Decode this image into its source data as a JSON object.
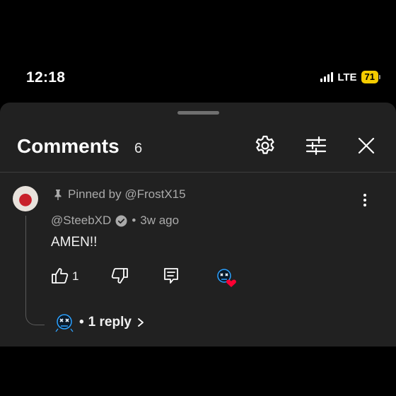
{
  "status_bar": {
    "time": "12:18",
    "network": "LTE",
    "battery": "71"
  },
  "header": {
    "title": "Comments",
    "count": "6"
  },
  "comment": {
    "pinned_label": "Pinned by @FrostX15",
    "author": "@SteebXD",
    "separator": "•",
    "age": "3w ago",
    "text": "AMEN!!",
    "like_count": "1",
    "reply_bullet": "•",
    "reply_label": "1 reply"
  },
  "colors": {
    "sheet_bg": "#212121",
    "battery": "#f5cc00",
    "heart": "#ff0033",
    "creator_avatar": "#2fa3ff"
  }
}
